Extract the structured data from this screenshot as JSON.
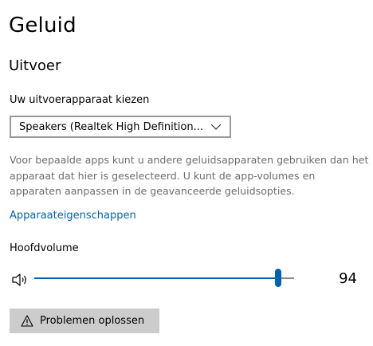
{
  "page": {
    "title": "Geluid"
  },
  "output": {
    "section_title": "Uitvoer",
    "device_label": "Uw uitvoerapparaat kiezen",
    "device_selected": "Speakers (Realtek High Definition...",
    "description": "Voor bepaalde apps kunt u andere geluidsapparaten gebruiken dan het apparaat dat hier is geselecteerd. U kunt de app-volumes en apparaten aanpassen in de geavanceerde geluidsopties.",
    "device_properties_link": "Apparaateigenschappen",
    "master_volume_label": "Hoofdvolume",
    "volume": {
      "value": "94",
      "level": 0.94
    },
    "troubleshoot_label": "Problemen oplossen"
  },
  "colors": {
    "accent": "#0063b1",
    "track": "#8a8a8a",
    "button_bg": "#cccccc",
    "secondary_text": "#6d6d6d"
  },
  "icons": {
    "dropdown": "chevron-down-icon",
    "speaker": "speaker-icon",
    "warning": "warning-icon"
  }
}
